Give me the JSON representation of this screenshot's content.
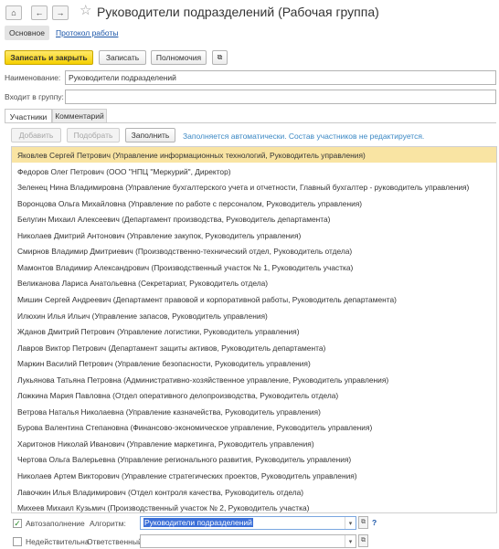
{
  "header": {
    "title": "Руководители подразделений (Рабочая группа)",
    "home_icon": "home-icon",
    "back_icon": "arrow-left-icon",
    "forward_icon": "arrow-right-icon",
    "favorite_icon": "star-icon"
  },
  "form_tabs": {
    "main": "Основное",
    "protocol": "Протокол работы"
  },
  "toolbar": {
    "save_close": "Записать и закрыть",
    "save": "Записать",
    "permissions": "Полномочия"
  },
  "fields": {
    "name_label": "Наименование:",
    "name_value": "Руководители подразделений",
    "group_label": "Входит в группу:",
    "group_value": ""
  },
  "inner_tabs": {
    "participants": "Участники",
    "comment": "Комментарий"
  },
  "list_toolbar": {
    "add": "Добавить",
    "pick": "Подобрать",
    "fill": "Заполнить",
    "note": "Заполняется автоматически. Состав участников не редактируется."
  },
  "participants": [
    "Яковлев Сергей Петрович (Управление информационных технологий, Руководитель управления)",
    "Федоров Олег Петрович (ООО \"НПЦ \"Меркурий\", Директор)",
    "Зеленец Нина Владимировна (Управление бухгалтерского учета и отчетности, Главный бухгалтер - руководитель управления)",
    "Воронцова Ольга Михайловна (Управление по работе с персоналом, Руководитель управления)",
    "Белугин Михаил Алексеевич (Департамент производства, Руководитель департамента)",
    "Николаев Дмитрий Антонович (Управление закупок, Руководитель управления)",
    "Смирнов Владимир Дмитриевич (Производственно-технический отдел, Руководитель отдела)",
    "Мамонтов Владимир Александрович (Производственный участок № 1, Руководитель участка)",
    "Великанова Лариса Анатольевна (Секретариат, Руководитель отдела)",
    "Мишин Сергей Андреевич (Департамент правовой и корпоративной работы, Руководитель департамента)",
    "Илюхин Илья Ильич (Управление запасов, Руководитель управления)",
    "Жданов Дмитрий Петрович (Управление логистики, Руководитель управления)",
    "Лавров Виктор Петрович (Департамент защиты активов, Руководитель департамента)",
    "Маркин Василий Петрович (Управление безопасности, Руководитель управления)",
    "Лукьянова Татьяна Петровна (Административно-хозяйственное управление, Руководитель управления)",
    "Ложкина Мария Павловна (Отдел оперативного делопроизводства, Руководитель отдела)",
    "Ветрова Наталья Николаевна (Управление казначейства, Руководитель управления)",
    "Бурова Валентина Степановна (Финансово-экономическое управление, Руководитель управления)",
    "Харитонов Николай Иванович (Управление маркетинга, Руководитель управления)",
    "Чертова Ольга Валерьевна (Управление регионального развития, Руководитель управления)",
    "Николаев Артем Викторович (Управление стратегических проектов, Руководитель управления)",
    "Лавочкин Илья Владимирович (Отдел контроля качества, Руководитель отдела)",
    "Михеев Михаил Кузьмич (Производственный участок № 2, Руководитель участка)"
  ],
  "bottom": {
    "autofill_label": "Автозаполнение",
    "autofill_checked": true,
    "algorithm_label": "Алгоритм:",
    "algorithm_value": "Руководители подразделений",
    "invalid_label": "Недействительна",
    "invalid_checked": false,
    "responsible_label": "Ответственный:",
    "responsible_value": "",
    "help": "?"
  },
  "colors": {
    "accent_button": "#f5d000",
    "selected_row": "#f9e4a3",
    "link": "#1a55a8",
    "note": "#3b88c4",
    "selected_text": "#3b6fd8"
  }
}
